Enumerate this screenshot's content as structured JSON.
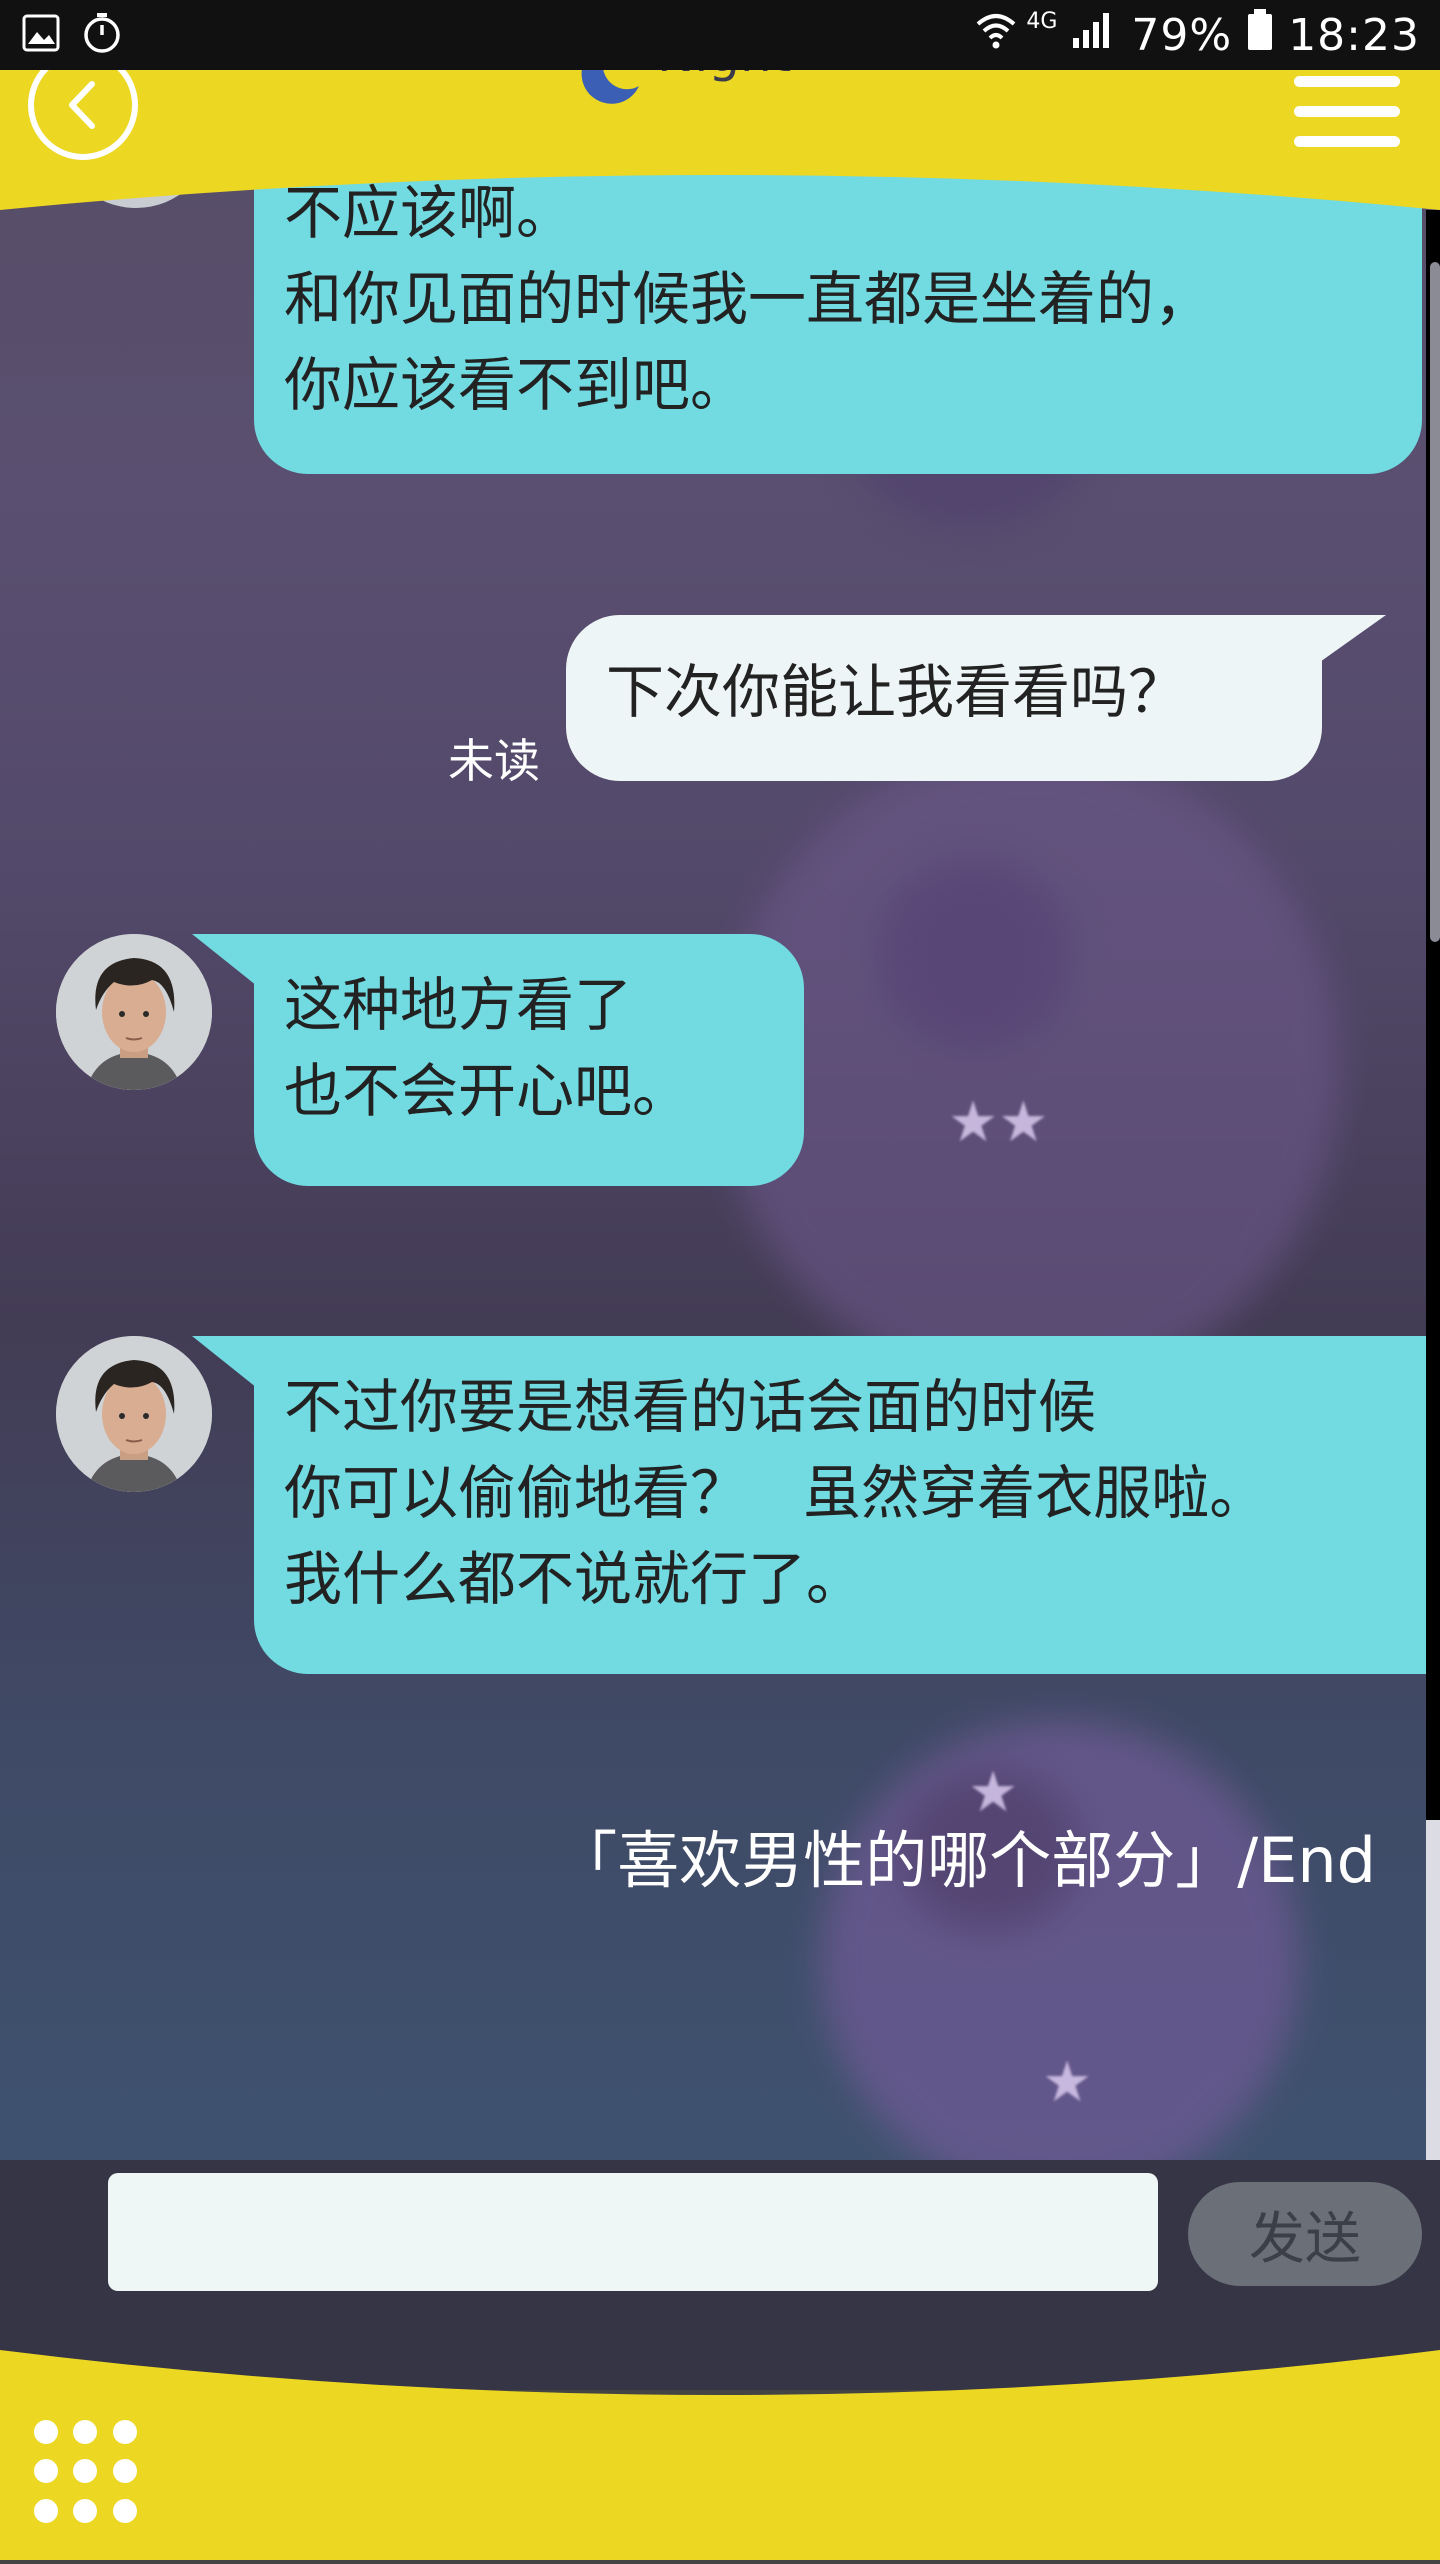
{
  "status_bar": {
    "network": "4G",
    "battery_percent": "79%",
    "time": "18:23"
  },
  "header": {
    "title": "Night"
  },
  "messages": [
    {
      "from": "them",
      "lines": [
        "不应该啊。",
        "和你见面的时候我一直都是坐着的，",
        "你应该看不到吧。"
      ]
    },
    {
      "from": "me",
      "lines": [
        "下次你能让我看看吗？"
      ],
      "status": "未读"
    },
    {
      "from": "them",
      "lines": [
        "这种地方看了",
        "也不会开心吧。"
      ]
    },
    {
      "from": "them",
      "lines": [
        "不过你要是想看的话会面的时候",
        "你可以偷偷地看？   虽然穿着衣服啦。",
        "我什么都不说就行了。"
      ]
    }
  ],
  "end_text": "「喜欢男性的哪个部分」/End",
  "input": {
    "value": "",
    "placeholder": "",
    "send_label": "发送"
  },
  "colors": {
    "header_yellow": "#ecd723",
    "bubble_incoming": "#72dae1",
    "bubble_outgoing": "#eef5f6",
    "input_bar": "#363545"
  }
}
